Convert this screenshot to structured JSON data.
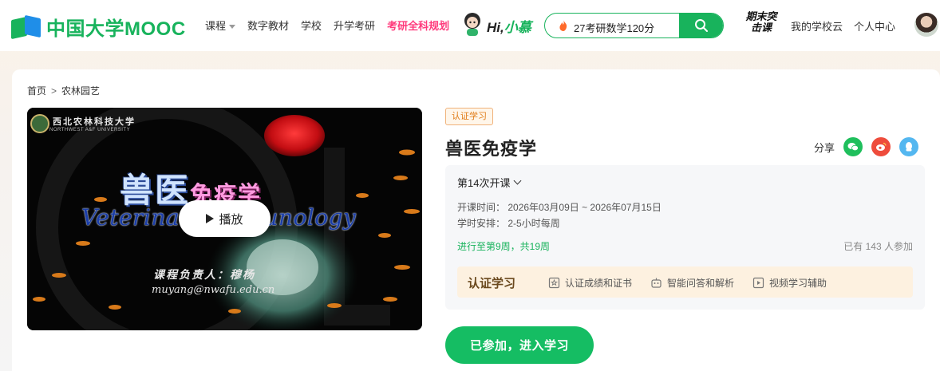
{
  "header": {
    "logo_text": "中国大学MOOC",
    "nav": [
      {
        "label": "课程",
        "has_caret": true
      },
      {
        "label": "数字教材"
      },
      {
        "label": "学校"
      },
      {
        "label": "升学考研"
      },
      {
        "label": "考研全科规划",
        "highlight": true
      }
    ],
    "greeting": "Hi,",
    "greeting_name": "小慕",
    "search": {
      "value": "27考研数学120分",
      "icon": "search-icon"
    },
    "promo_text": "期末突击课",
    "links": [
      "我的学校云",
      "个人中心"
    ]
  },
  "breadcrumb": {
    "home": "首页",
    "separator": ">",
    "current": "农林园艺"
  },
  "video": {
    "university_cn": "西北农林科技大学",
    "university_en": "NORTHWEST A&F UNIVERSITY",
    "title_a": "兽医",
    "title_b": "免疫学",
    "title_en": "Veterinary Immunology",
    "instructor_line": "课程负责人：穆杨",
    "email": "muyang@nwafu.edu.cn",
    "play_label": "播放"
  },
  "course": {
    "badge": "认证学习",
    "title": "兽医免疫学",
    "share_label": "分享",
    "share_icons": [
      "wechat-icon",
      "weibo-icon",
      "qq-icon"
    ],
    "term": "第14次开课",
    "schedule_label": "开课时间：",
    "schedule_value": "2026年03月09日 ~ 2026年07月15日",
    "hours_label": "学时安排：",
    "hours_value": "2-5小时每周",
    "progress": "进行至第9周，共19周",
    "joined": "已有 143 人参加",
    "cert_label": "认证学习",
    "cert_features": [
      "认证成绩和证书",
      "智能问答和解析",
      "视频学习辅助"
    ],
    "enter_label": "已参加，进入学习"
  },
  "colors": {
    "brand_green": "#18b35c",
    "brand_blue": "#1f8ee8",
    "hot_pink": "#ff3a7c",
    "badge_orange": "#e07b16",
    "cert_bg": "#fdf1e0"
  }
}
